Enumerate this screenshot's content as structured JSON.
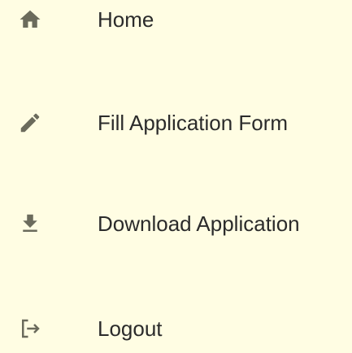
{
  "nav": {
    "items": [
      {
        "label": "Home",
        "icon": "home-icon"
      },
      {
        "label": "Fill Application Form",
        "icon": "pencil-icon"
      },
      {
        "label": "Download Application",
        "icon": "download-icon"
      },
      {
        "label": "Logout",
        "icon": "logout-icon"
      }
    ]
  },
  "colors": {
    "background": "#fffde3",
    "icon": "#6b6b5c",
    "text": "#2b2b2b"
  }
}
